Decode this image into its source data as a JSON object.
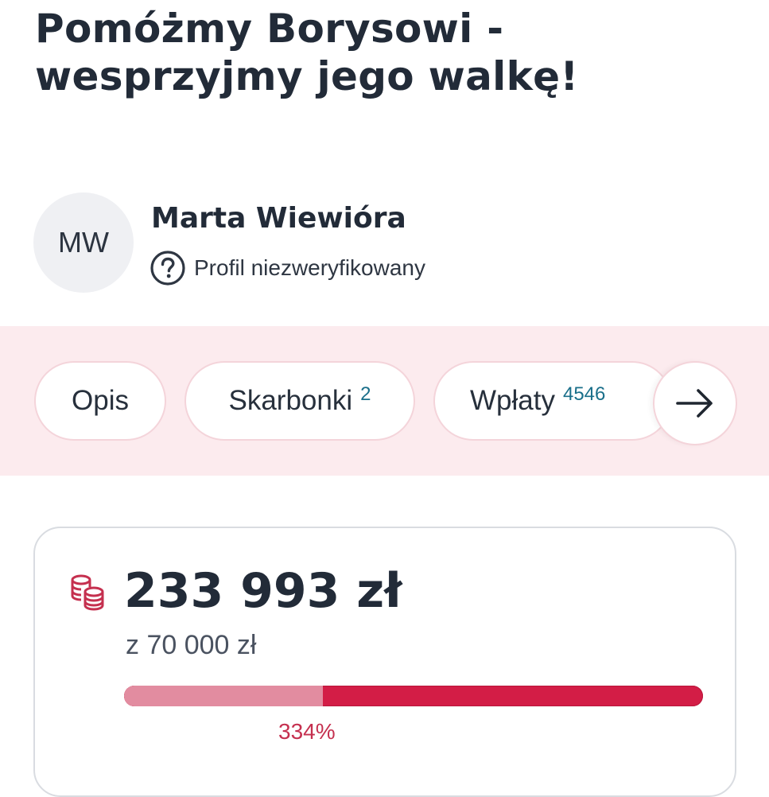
{
  "page": {
    "title_line1": "Pomóżmy Borysowi -",
    "title_line2": "wesprzyjmy jego walkę!"
  },
  "author": {
    "initials": "MW",
    "name": "Marta Wiewióra",
    "verification_status": "Profil niezweryfikowany",
    "verification_icon": "question-circle-icon"
  },
  "tabs": [
    {
      "label": "Opis",
      "count": ""
    },
    {
      "label": "Skarbonki",
      "count": "2"
    },
    {
      "label": "Wpłaty",
      "count": "4546"
    }
  ],
  "tabs_next_icon": "arrow-right-icon",
  "fundraiser": {
    "icon": "coins-icon",
    "raised": "233 993 zł",
    "goal": "z 70 000 zł",
    "percent_label": "334%",
    "progress_fill_fraction": 0.344
  },
  "colors": {
    "text": "#222b38",
    "accent": "#d31d46",
    "accent_light": "#e28ca0",
    "tabs_band": "#fcebee",
    "badge": "#1a6f8a"
  }
}
